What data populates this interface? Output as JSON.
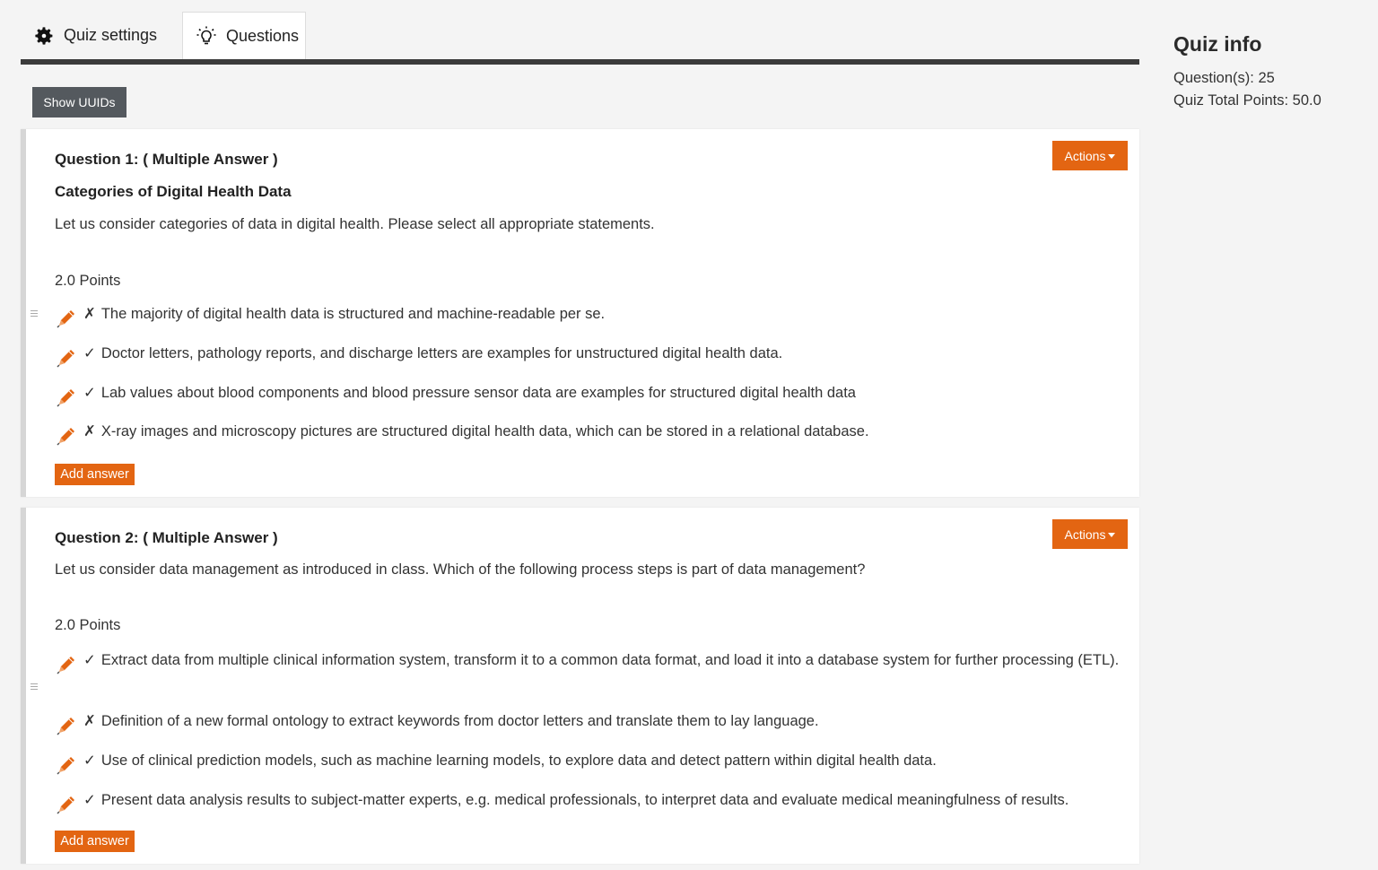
{
  "tabs": {
    "settings_label": "Quiz settings",
    "questions_label": "Questions"
  },
  "toolbar": {
    "show_uuids": "Show UUIDs"
  },
  "questions": [
    {
      "title": "Question 1: ( Multiple Answer )",
      "subtitle": "Categories of Digital Health Data",
      "text": "Let us consider categories of data in digital health. Please select all appropriate statements.",
      "points": "2.0 Points",
      "actions_label": "Actions",
      "add_answer_label": "Add answer",
      "answers": [
        {
          "mark": "✗",
          "text": "The majority of digital health data is structured and machine-readable per se."
        },
        {
          "mark": "✓",
          "text": "Doctor letters, pathology reports, and discharge letters are examples for unstructured digital health data."
        },
        {
          "mark": "✓",
          "text": "Lab values about blood components and blood pressure sensor data are examples for structured digital health data"
        },
        {
          "mark": "✗",
          "text": "X-ray images and microscopy pictures are structured digital health data, which can be stored in a relational database."
        }
      ]
    },
    {
      "title": "Question 2: ( Multiple Answer )",
      "text": "Let us consider data management as introduced in class. Which of the following process steps is part of data management?",
      "points": "2.0 Points",
      "actions_label": "Actions",
      "add_answer_label": "Add answer",
      "answers": [
        {
          "mark": "✓",
          "text": "Extract data from multiple clinical information system, transform it to a common data format, and load it into a database system for further processing (ETL)."
        },
        {
          "mark": "✗",
          "text": "Definition of a new formal ontology to extract keywords from doctor letters and translate them to lay language."
        },
        {
          "mark": "✓",
          "text": "Use of clinical prediction models, such as machine learning models, to explore data and detect pattern within digital health data."
        },
        {
          "mark": "✓",
          "text": "Present data analysis results to subject-matter experts, e.g. medical professionals, to interpret data and evaluate medical meaningfulness of results."
        }
      ]
    }
  ],
  "quiz_info": {
    "heading": "Quiz info",
    "questions_count": "Question(s): 25",
    "total_points": "Quiz Total Points: 50.0"
  },
  "colors": {
    "accent": "#e36512",
    "tab_bar": "#3b3b3b",
    "uuid_button": "#54595e"
  },
  "icons": {
    "settings": "gear-icon",
    "questions": "lightbulb-icon",
    "answer_edit": "pencil-icon",
    "drag": "drag-handle-icon"
  }
}
